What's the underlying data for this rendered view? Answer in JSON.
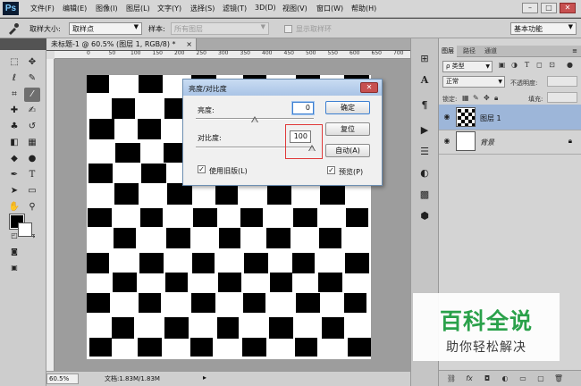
{
  "app": {
    "logo": "Ps",
    "menu": [
      "文件(F)",
      "编辑(E)",
      "图像(I)",
      "图层(L)",
      "文字(Y)",
      "选择(S)",
      "滤镜(T)",
      "3D(D)",
      "视图(V)",
      "窗口(W)",
      "帮助(H)"
    ],
    "window_controls": [
      "–",
      "□",
      "✕"
    ]
  },
  "options_bar": {
    "sample_size_label": "取样大小:",
    "sample_size_value": "取样点",
    "sample_label": "样本:",
    "sample_value": "所有图层",
    "show_ring_label": "显示取样环",
    "workspace": "基本功能"
  },
  "document": {
    "tab_title": "未标题-1 @ 60.5% (图层 1, RGB/8) *",
    "tab_close": "×",
    "ruler_ticks": [
      "0",
      "50",
      "100",
      "150",
      "200",
      "250",
      "300",
      "350",
      "400",
      "450",
      "500",
      "550",
      "600",
      "650",
      "700",
      "750"
    ],
    "zoom": "60.5%",
    "doc_info": "文档:1.83M/1.83M"
  },
  "dialog": {
    "title": "亮度/对比度",
    "brightness_label": "亮度:",
    "brightness_value": "0",
    "contrast_label": "对比度:",
    "contrast_value": "100",
    "legacy_label": "使用旧版(L)",
    "legacy_checked": true,
    "ok_label": "确定",
    "reset_label": "复位",
    "auto_label": "自动(A)",
    "preview_label": "预览(P)",
    "preview_checked": true,
    "close": "✕"
  },
  "layers_panel": {
    "tabs": [
      "图层",
      "路径",
      "通道"
    ],
    "filter_value": "ρ 类型",
    "blend_mode": "正常",
    "opacity_label": "不透明度:",
    "lock_label": "锁定:",
    "fill_label": "填充:",
    "layers": [
      {
        "name": "图层 1",
        "selected": true
      },
      {
        "name": "背景",
        "selected": false,
        "locked": true
      }
    ]
  },
  "watermark": {
    "title": "百科全说",
    "subtitle": "助你轻松解决"
  },
  "colors": {
    "highlight_box": "#e03a3a",
    "watermark_green": "#2aa14a",
    "selected_layer": "#9db6d9"
  }
}
